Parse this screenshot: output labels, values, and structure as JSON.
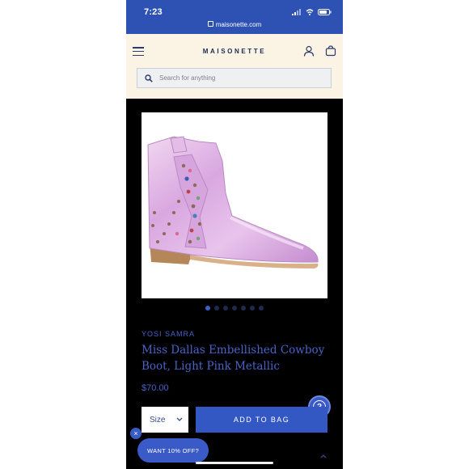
{
  "status_bar": {
    "time": "7:23"
  },
  "browser": {
    "url": "maisonette.com"
  },
  "header": {
    "logo": "MAISONETTE",
    "search": {
      "placeholder": "Search for anything"
    }
  },
  "gallery": {
    "image_count": 7,
    "active_index": 0
  },
  "product": {
    "brand": "YOSI SAMRA",
    "title": "Miss Dallas Embellished Cowboy Boot, Light Pink Metallic",
    "price": "$70.00"
  },
  "actions": {
    "size_label": "Size",
    "add_to_bag": "ADD TO BAG"
  },
  "promo": {
    "label": "WANT 10% OFF?",
    "close_symbol": "×"
  },
  "help": {
    "symbol": "?"
  },
  "colors": {
    "brand_blue": "#3358c4",
    "header_bg": "#fbf3e3",
    "page_bg": "#000000"
  },
  "icons": [
    "menu-icon",
    "account-icon",
    "bag-icon",
    "search-icon",
    "chevron-down-icon",
    "help-icon",
    "close-icon",
    "chevron-up-icon",
    "lock-icon"
  ]
}
